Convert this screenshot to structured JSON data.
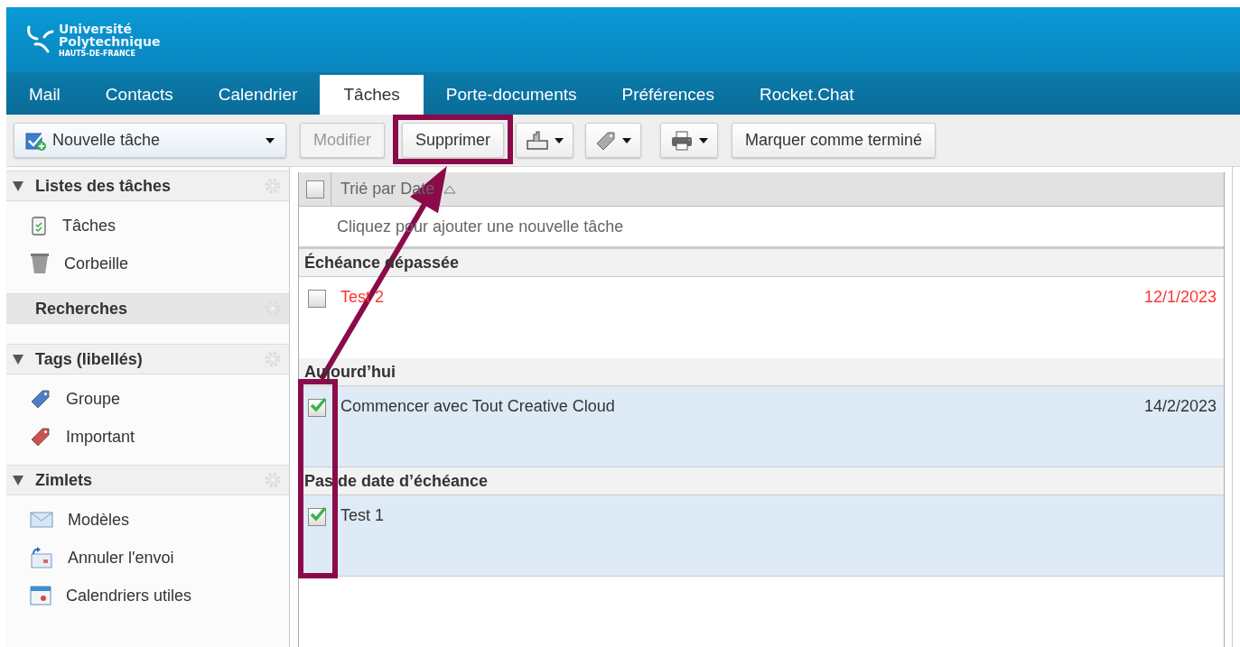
{
  "logo": {
    "line_1": "Université",
    "line_2": "Polytechnique",
    "subtitle": "HAUTS-DE-FRANCE"
  },
  "tabs": [
    {
      "label": "Mail",
      "selected": false
    },
    {
      "label": "Contacts",
      "selected": false
    },
    {
      "label": "Calendrier",
      "selected": false
    },
    {
      "label": "Tâches",
      "selected": true
    },
    {
      "label": "Porte-documents",
      "selected": false
    },
    {
      "label": "Préférences",
      "selected": false
    },
    {
      "label": "Rocket.Chat",
      "selected": false
    }
  ],
  "toolbar": {
    "new_button": {
      "label": "Nouvelle tâche"
    },
    "buttons": [
      {
        "kind": "text",
        "label": "Modifier",
        "disabled": true
      },
      {
        "kind": "text",
        "label": "Supprimer",
        "disabled": false
      },
      {
        "kind": "icon"
      },
      {
        "kind": "icon"
      },
      {
        "kind": "icon"
      },
      {
        "kind": "text",
        "label": "Marquer comme terminé",
        "disabled": false
      }
    ]
  },
  "sidebar": {
    "sections": [
      {
        "title": "Listes des tâches",
        "kind": "collapsible",
        "expanded": true,
        "items": [
          {
            "label": "Tâches"
          },
          {
            "label": "Corbeille"
          }
        ]
      },
      {
        "title": "Recherches",
        "kind": "plain"
      },
      {
        "title": "Tags (libellés)",
        "kind": "collapsible",
        "expanded": true,
        "items": [
          {
            "label": "Groupe",
            "color": "#4a7fc8"
          },
          {
            "label": "Important",
            "color": "#d05050"
          }
        ]
      },
      {
        "title": "Zimlets",
        "kind": "collapsible",
        "expanded": true,
        "items": [
          {
            "label": "Modèles"
          },
          {
            "label": "Annuler l'envoi"
          },
          {
            "label": "Calendriers utiles"
          }
        ]
      }
    ]
  },
  "task_list": {
    "select_all": {
      "checked": false
    },
    "sort_label": "Trié par Date",
    "add_prompt": "Cliquez pour ajouter une nouvelle tâche",
    "groups": [
      {
        "title": "Échéance dépassée",
        "tasks": [
          {
            "title": "Test 2",
            "date": "12/1/2023",
            "overdue": true,
            "checked": false,
            "selected": false
          }
        ]
      },
      {
        "title": "Aujourd’hui",
        "tasks": [
          {
            "title": "Commencer avec Tout Creative Cloud",
            "date": "14/2/2023",
            "overdue": false,
            "checked": true,
            "selected": true
          }
        ]
      },
      {
        "title": "Pas de date d’échéance",
        "tasks": [
          {
            "title": "Test 1",
            "overdue": false,
            "checked": true,
            "selected": true
          }
        ]
      }
    ]
  }
}
